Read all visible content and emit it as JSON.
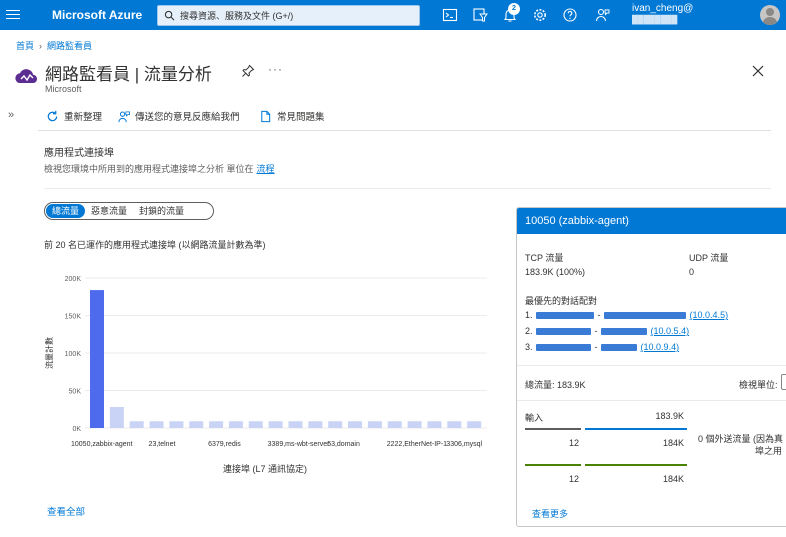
{
  "header": {
    "brand": "Microsoft Azure",
    "search_placeholder": "搜尋資源、服務及文件 (G+/)",
    "notification_count": "2",
    "user_name": "ivan_cheng@",
    "user_org": "████████"
  },
  "breadcrumb": {
    "home": "首頁",
    "parent": "網路監看員"
  },
  "blade": {
    "title": "網路監看員 | 流量分析",
    "subtitle": "Microsoft",
    "more": "···"
  },
  "commands": {
    "refresh": "重新整理",
    "feedback": "傳送您的意見反應給我們",
    "faq": "常見問題集"
  },
  "section": {
    "title": "應用程式連接埠",
    "description": "檢視您環境中所用到的應用程式連接埠之分析 單位在",
    "description_link": "流程"
  },
  "toggle": {
    "items": [
      "總流量",
      "惡意流量",
      "封鎖的流量"
    ],
    "active_index": 0
  },
  "chart_caption": "前 20 名已運作的應用程式連接埠 (以網路流量計數為準)",
  "view_all": "查看全部",
  "chart_data": {
    "type": "bar",
    "ylabel": "流量計數",
    "xlabel": "連接埠 (L7 通訊協定)",
    "ylim": [
      0,
      200000
    ],
    "yticks": [
      0,
      50000,
      100000,
      150000,
      200000
    ],
    "ytick_labels": [
      "0K",
      "50K",
      "100K",
      "150K",
      "200K"
    ],
    "xtick_labels": [
      "10050,zabbix-agent",
      "23,telnet",
      "6379,redis",
      "3389,ms-wbt-server",
      "53,domain",
      "2222,EtherNet-IP-1",
      "3306,mysql"
    ],
    "xtick_positions": [
      0,
      3,
      6,
      9,
      12,
      15,
      18
    ],
    "values": [
      183900,
      28000,
      9000,
      9000,
      9000,
      9000,
      9000,
      9000,
      9000,
      9000,
      9000,
      9000,
      9000,
      9000,
      9000,
      9000,
      9000,
      9000,
      9000,
      9000
    ],
    "highlight_index": 0,
    "colors": {
      "highlight": "#4f6bed",
      "normal": "#c9d3f5",
      "grid": "#edebe9"
    }
  },
  "panel": {
    "title": "10050 (zabbix-agent)",
    "tcp_label": "TCP 流量",
    "tcp_value": "183.9K (100%)",
    "udp_label": "UDP 流量",
    "udp_value": "0",
    "top_pairs_label": "最優先的對話配對",
    "pairs": [
      {
        "num": "1.",
        "ip": "(10.0.4.5)"
      },
      {
        "num": "2.",
        "ip": "(10.0.5.4)"
      },
      {
        "num": "3.",
        "ip": "(10.0.9.4)"
      }
    ],
    "total_label": "總流量: 183.9K",
    "view_unit_label": "檢視單位:",
    "inbound_label": "輸入",
    "inbound_value": "183.9K",
    "row1_left": "12",
    "row1_right": "184K",
    "row2_left": "12",
    "row2_right": "184K",
    "outbound_note_1": "0 個外送流量 (因為真",
    "outbound_note_2": "埠之用",
    "see_more": "查看更多"
  }
}
